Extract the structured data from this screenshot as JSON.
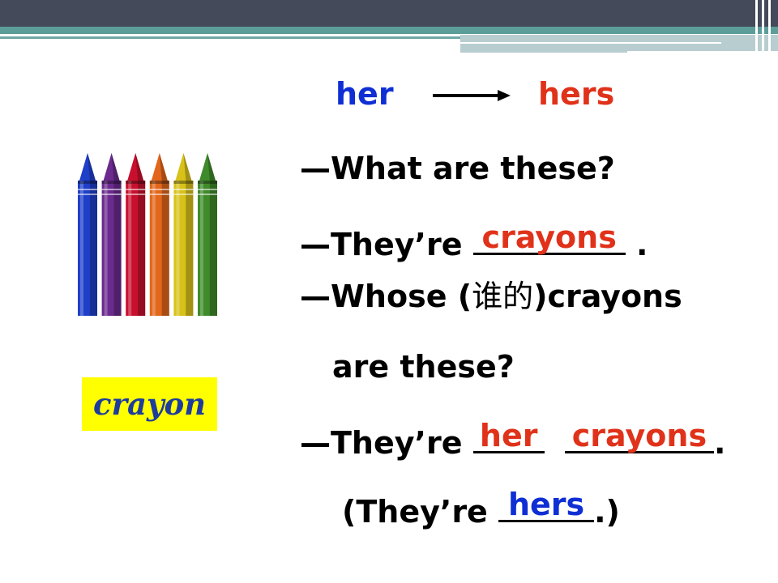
{
  "word_pair": {
    "from": "her",
    "to": "hers"
  },
  "dialogue": {
    "q1": "—What are these?",
    "a1_prefix": "—They’re",
    "a1_answer": "crayons",
    "a1_suffix": ".",
    "q2_part1": "—Whose (",
    "q2_chinese": "谁的",
    "q2_part2": ")crayons",
    "q2_line2": "are these?",
    "a2_prefix": "—They’re",
    "a2_answer1": "her",
    "a2_answer2": "crayons",
    "a2_suffix": ".",
    "a3_prefix": "(They’re",
    "a3_answer": "hers",
    "a3_suffix": ".)"
  },
  "vocab_label": "crayon",
  "crayon_colors": [
    "#1F3FC9",
    "#6B2A8E",
    "#C8102E",
    "#E2661B",
    "#D8C21A",
    "#3F8A2A"
  ],
  "colors": {
    "header_dark": "#454A5A",
    "header_teal": "#5C9D9A",
    "blue_text": "#0F2FD4",
    "red_text": "#E0321A",
    "label_bg": "#FFFF00"
  }
}
